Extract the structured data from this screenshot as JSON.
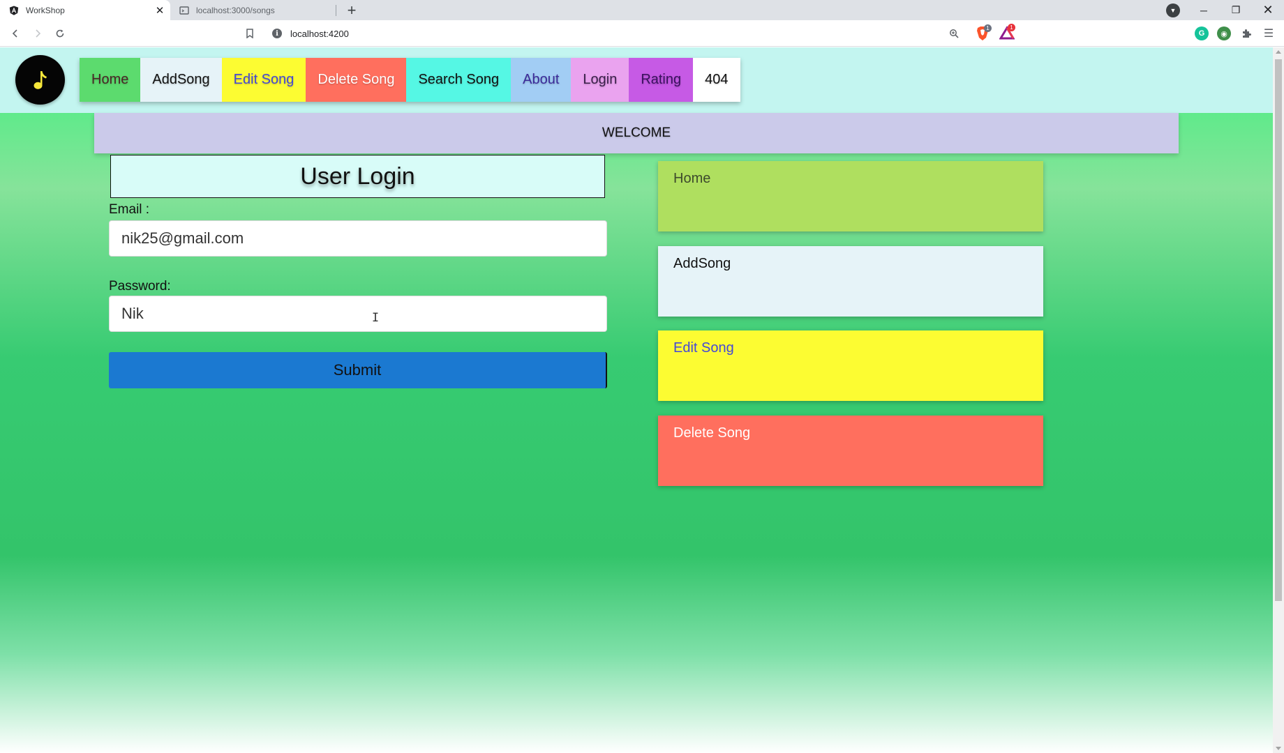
{
  "browser": {
    "tabs": [
      {
        "title": "WorkShop",
        "active": true,
        "favicon": "angular-icon"
      },
      {
        "title": "localhost:3000/songs",
        "active": false,
        "favicon": "page-icon"
      }
    ],
    "url": "localhost:4200",
    "shield_badge": "1",
    "rewards_badge": "1"
  },
  "header": {
    "logo_icon": "music-note-icon",
    "nav": [
      {
        "label": "Home",
        "bg": "#5cdb6e",
        "color": "#4a2626"
      },
      {
        "label": "AddSong",
        "bg": "#e6f3f8",
        "color": "#111111"
      },
      {
        "label": "Edit Song",
        "bg": "#fcfc32",
        "color": "#4447d8"
      },
      {
        "label": "Delete Song",
        "bg": "#ff6f5e",
        "color": "#ffffff"
      },
      {
        "label": "Search Song",
        "bg": "#55f7e4",
        "color": "#111111"
      },
      {
        "label": "About",
        "bg": "#a2cdf4",
        "color": "#3b2a9a"
      },
      {
        "label": "Login",
        "bg": "#eaa3ef",
        "color": "#3a1f4a"
      },
      {
        "label": "Rating",
        "bg": "#c65ae5",
        "color": "#3a1060"
      },
      {
        "label": "404",
        "bg": "#ffffff",
        "color": "#111111"
      }
    ]
  },
  "welcome": "WELCOME",
  "login": {
    "title": "User Login",
    "email_label": "Email :",
    "email_value": "nik25@gmail.com",
    "password_label": "Password:",
    "password_value": "Nik",
    "submit_label": "Submit"
  },
  "cards": [
    {
      "label": "Home",
      "bg": "#afdf5f",
      "color": "#3d4a2c"
    },
    {
      "label": "AddSong",
      "bg": "#e6f3f8",
      "color": "#111111"
    },
    {
      "label": "Edit Song",
      "bg": "#fcfc32",
      "color": "#4447d8"
    },
    {
      "label": "Delete Song",
      "bg": "#ff6f5e",
      "color": "#ffffff"
    }
  ]
}
